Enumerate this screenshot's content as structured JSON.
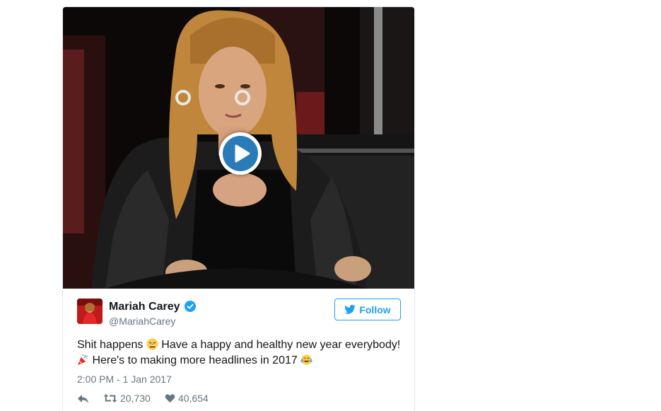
{
  "media": {
    "type": "video",
    "play_icon": "play-icon"
  },
  "tweet": {
    "author_name": "Mariah Carey",
    "author_handle": "@MariahCarey",
    "verified_icon": "verified-badge-icon",
    "follow_label": "Follow",
    "text_part1": "Shit happens ",
    "text_part2": " Have a happy and healthy new year everybody!",
    "text_part3": " Here's to making more headlines in 2017 ",
    "timestamp": "2:00 PM - 1 Jan 2017",
    "retweets": "20,730",
    "likes": "40,654"
  },
  "colors": {
    "follow_blue": "#1da1f2",
    "play_blue": "#2b7bb9",
    "text": "#14171a",
    "muted": "#657786",
    "border": "#e1e8ed"
  }
}
